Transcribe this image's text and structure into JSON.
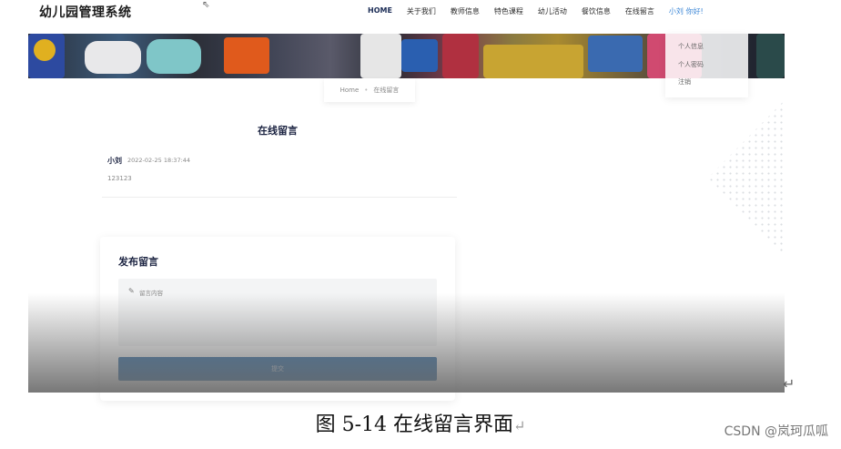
{
  "app": {
    "brand": "幼儿园管理系统"
  },
  "nav": {
    "items": [
      {
        "label": "HOME"
      },
      {
        "label": "关于我们"
      },
      {
        "label": "教师信息"
      },
      {
        "label": "特色课程"
      },
      {
        "label": "幼儿活动"
      },
      {
        "label": "餐饮信息"
      },
      {
        "label": "在线留言"
      }
    ],
    "user_greeting": "小刘 你好!"
  },
  "user_menu": {
    "items": [
      "个人信息",
      "个人密码",
      "注销"
    ]
  },
  "breadcrumb": {
    "home": "Home",
    "separator": "•",
    "current": "在线留言"
  },
  "messages": {
    "title": "在线留言",
    "list": [
      {
        "user": "小刘",
        "time": "2022-02-25 18:37:44",
        "content": "123123"
      }
    ]
  },
  "form": {
    "title": "发布留言",
    "placeholder": "留言内容",
    "submit_label": "提交"
  },
  "caption": {
    "text": "图  5-14  在线留言界面",
    "return_symbol": "↵"
  },
  "watermark": "CSDN @岚珂瓜呱",
  "colors": {
    "accent": "#2f6ea8",
    "title": "#1a2240",
    "user_link": "#3b86d6"
  }
}
